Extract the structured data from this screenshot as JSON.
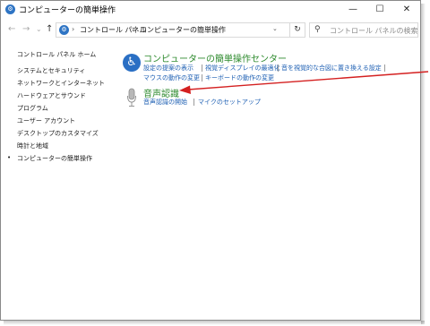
{
  "window": {
    "title": "コンピューターの簡単操作",
    "minimize": "—",
    "maximize": "☐",
    "close": "✕"
  },
  "nav": {
    "back": "←",
    "forward": "→",
    "recent": "⌄",
    "up": "↑"
  },
  "address": {
    "crumbs": [
      "コントロール パネル",
      "コンピューターの簡単操作"
    ],
    "separator": "›",
    "dropdown": "⌄",
    "refresh": "↻"
  },
  "search": {
    "placeholder": "コントロール パネルの検索"
  },
  "sidebar": {
    "home": "コントロール パネル ホーム",
    "items": [
      "システムとセキュリティ",
      "ネットワークとインターネット",
      "ハードウェアとサウンド",
      "プログラム",
      "ユーザー アカウント",
      "デスクトップのカスタマイズ",
      "時計と地域",
      "コンピューターの簡単操作"
    ],
    "bullet": "•"
  },
  "categories": [
    {
      "title": "コンピューターの簡単操作センター",
      "links": [
        "設定の提案の表示",
        "視覚ディスプレイの最適化",
        "音を視覚的な合図に置き換える設定",
        "マウスの動作の変更",
        "キーボードの動作の変更"
      ]
    },
    {
      "title": "音声認識",
      "links": [
        "音声認識の開始",
        "マイクのセットアップ"
      ]
    }
  ],
  "colors": {
    "accent_link": "#1d5fb3",
    "category_title": "#2d8a2d",
    "annotation_arrow": "#d42020"
  }
}
